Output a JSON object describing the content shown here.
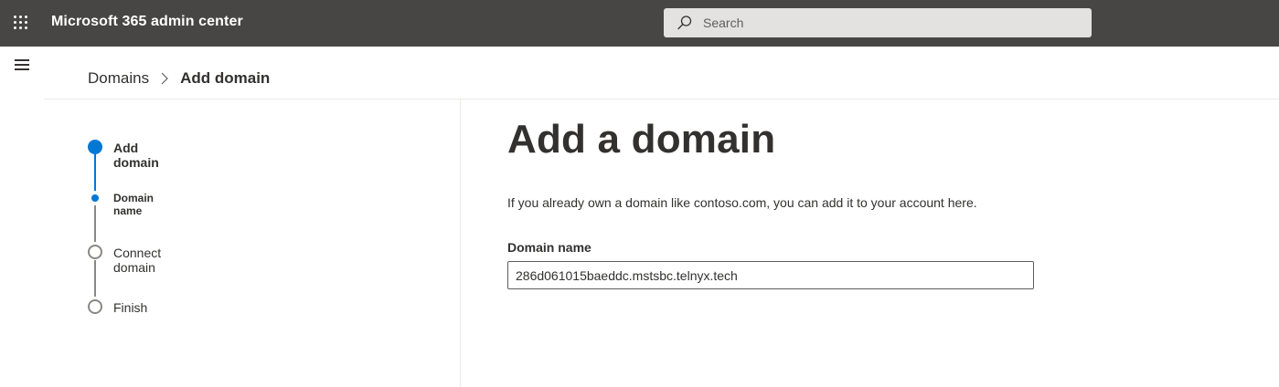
{
  "header": {
    "app_title": "Microsoft 365 admin center",
    "search_placeholder": "Search",
    "background_color": "#484644"
  },
  "breadcrumb": {
    "parent": "Domains",
    "current": "Add domain"
  },
  "stepper": {
    "accent_color": "#0078d4",
    "steps": [
      {
        "label": "Add domain",
        "state": "active"
      },
      {
        "label": "Domain name",
        "state": "active-substep"
      },
      {
        "label": "Connect domain",
        "state": "pending"
      },
      {
        "label": "Finish",
        "state": "pending"
      }
    ]
  },
  "main": {
    "title": "Add a domain",
    "intro": "If you already own a domain like contoso.com, you can add it to your account here.",
    "domain_field": {
      "label": "Domain name",
      "value": "286d061015baeddc.mstsbc.telnyx.tech"
    }
  }
}
